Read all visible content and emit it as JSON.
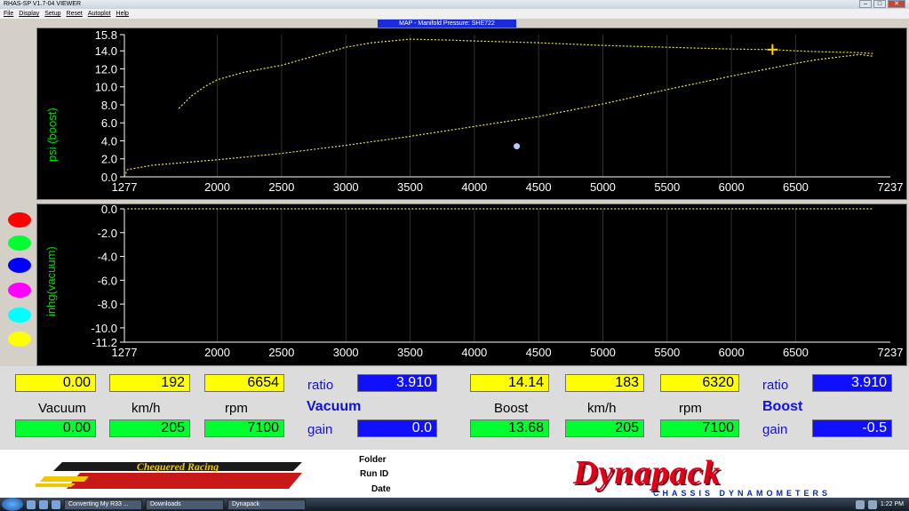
{
  "window": {
    "title": "RHAS-SP V1.7-04  VIEWER"
  },
  "menu": [
    "File",
    "Display",
    "Setup",
    "Reset",
    "Autoplot",
    "Help"
  ],
  "plot_title": "MAP - Manifold Pressure: SHE722",
  "chart_data": [
    {
      "type": "line",
      "ylabel": "psi (boost)",
      "xlim": [
        1277,
        7237
      ],
      "ylim": [
        0,
        15.8
      ],
      "x_ticks": [
        "1277",
        "2000",
        "2500",
        "3000",
        "3500",
        "4000",
        "4500",
        "5000",
        "5500",
        "6000",
        "6500",
        "7237"
      ],
      "y_ticks": [
        "15.8",
        "14.0",
        "12.0",
        "10.0",
        "8.0",
        "6.0",
        "4.0",
        "2.0",
        "0.0"
      ],
      "series": [
        {
          "color": "#e8e850",
          "x": [
            1700,
            1800,
            1900,
            2000,
            2200,
            2500,
            2700,
            3000,
            3200,
            3500,
            3800,
            4000,
            4500,
            5000,
            5500,
            6000,
            6320,
            6500,
            6700,
            7000,
            7100
          ],
          "y": [
            7.6,
            9.0,
            10.0,
            10.8,
            11.6,
            12.4,
            13.2,
            14.4,
            14.9,
            15.3,
            15.2,
            15.1,
            14.9,
            14.6,
            14.4,
            14.2,
            14.14,
            14.0,
            13.9,
            13.8,
            13.7
          ]
        },
        {
          "color": "#e8e850",
          "x": [
            1277,
            1300,
            1500,
            2000,
            2500,
            3000,
            3500,
            4000,
            4500,
            5000,
            5500,
            6000,
            6500,
            6654,
            7000,
            7100
          ],
          "y": [
            0.0,
            0.8,
            1.3,
            1.9,
            2.6,
            3.5,
            4.5,
            5.6,
            6.7,
            8.1,
            9.7,
            11.2,
            12.6,
            13.0,
            13.6,
            13.4
          ]
        }
      ],
      "markers": [
        {
          "type": "cursor",
          "x": 6320,
          "y": 14.14
        },
        {
          "type": "point",
          "x": 4330,
          "y": 3.4
        }
      ]
    },
    {
      "type": "line",
      "ylabel": "inhg(vacuum)",
      "xlim": [
        1277,
        7237
      ],
      "ylim": [
        -11.2,
        0
      ],
      "x_ticks": [
        "1277",
        "2000",
        "2500",
        "3000",
        "3500",
        "4000",
        "4500",
        "5000",
        "5500",
        "6000",
        "6500",
        "7237"
      ],
      "y_ticks": [
        "0.0",
        "-2.0",
        "-4.0",
        "-6.0",
        "-8.0",
        "-10.0",
        "-11.2"
      ],
      "series": [
        {
          "color": "#e8e850",
          "x": [
            1300,
            7100
          ],
          "y": [
            0.0,
            0.0
          ]
        }
      ]
    }
  ],
  "readouts": {
    "left": {
      "top_vals": [
        "0.00",
        "192",
        "6654"
      ],
      "ratio_label": "ratio",
      "ratio": "3.910",
      "headers": [
        "Vacuum",
        "km/h",
        "rpm"
      ],
      "mode": "Vacuum",
      "bottom_vals": [
        "0.00",
        "205",
        "7100"
      ],
      "gain_label": "gain",
      "gain": "0.0"
    },
    "right": {
      "top_vals": [
        "14.14",
        "183",
        "6320"
      ],
      "ratio_label": "ratio",
      "ratio": "3.910",
      "headers": [
        "Boost",
        "km/h",
        "rpm"
      ],
      "mode": "Boost",
      "bottom_vals": [
        "13.68",
        "205",
        "7100"
      ],
      "gain_label": "gain",
      "gain": "-0.5"
    }
  },
  "channel_dots": [
    "#ff0000",
    "#00ff30",
    "#0000ff",
    "#ff00ff",
    "#00ffff",
    "#ffff00"
  ],
  "footer": {
    "logo_left": "Chequered Racing",
    "fields": [
      "Folder",
      "Run ID",
      "Date"
    ],
    "brand": "Dynapack",
    "brand_sub": "CHASSIS DYNAMOMETERS"
  },
  "taskbar": {
    "items": [
      "Converting My R33 ...",
      "Downloads",
      "Dynapack"
    ],
    "clock": "1:22 PM"
  }
}
